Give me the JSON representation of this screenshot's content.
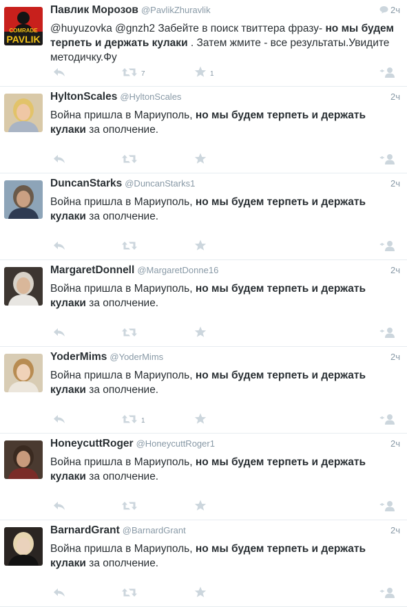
{
  "tweets": [
    {
      "name": "Павлик Морозов",
      "handle": "@PavlikZhuravlik",
      "time": "2ч",
      "has_conversation": true,
      "text": [
        {
          "t": "@huyuzovka @gnzh2 Забейте в поиск твиттера фразу- ",
          "b": false
        },
        {
          "t": "но мы будем терпеть и держать кулаки",
          "b": true
        },
        {
          "t": " . Затем жмите - все результаты.Увидите методичку.Фу",
          "b": false
        }
      ],
      "retweets": "7",
      "favorites": "1",
      "avatar": {
        "kind": "comrade",
        "top": "COMRADE",
        "bottom": "PAVLIK"
      }
    },
    {
      "name": "HyltonScales",
      "handle": "@HyltonScales",
      "time": "2ч",
      "has_conversation": false,
      "text": [
        {
          "t": "Война пришла в Мариуполь, ",
          "b": false
        },
        {
          "t": "но мы будем терпеть и держать кулаки",
          "b": true
        },
        {
          "t": " за ополчение.",
          "b": false
        }
      ],
      "retweets": "",
      "favorites": "",
      "avatar": {
        "kind": "photo",
        "bg": "#d9c9a8",
        "hair": "#e2c36a",
        "skin": "#efc7a5",
        "body": "#a9b4c4"
      }
    },
    {
      "name": "DuncanStarks",
      "handle": "@DuncanStarks1",
      "time": "2ч",
      "has_conversation": false,
      "text": [
        {
          "t": "Война пришла в Мариуполь, ",
          "b": false
        },
        {
          "t": "но мы будем терпеть и держать кулаки",
          "b": true
        },
        {
          "t": " за ополчение.",
          "b": false
        }
      ],
      "retweets": "",
      "favorites": "",
      "avatar": {
        "kind": "photo",
        "bg": "#8da4b8",
        "hair": "#6b5a4a",
        "skin": "#caa083",
        "body": "#2f3b52"
      }
    },
    {
      "name": "MargaretDonnell",
      "handle": "@MargaretDonne16",
      "time": "2ч",
      "has_conversation": false,
      "text": [
        {
          "t": "Война пришла в Мариуполь, ",
          "b": false
        },
        {
          "t": "но мы будем терпеть и держать кулаки",
          "b": true
        },
        {
          "t": " за ополчение.",
          "b": false
        }
      ],
      "retweets": "",
      "favorites": "",
      "avatar": {
        "kind": "photo",
        "bg": "#3d3631",
        "hair": "#d8d2c8",
        "skin": "#d9b79a",
        "body": "#e8e6e2"
      }
    },
    {
      "name": "YoderMims",
      "handle": "@YoderMims",
      "time": "2ч",
      "has_conversation": false,
      "text": [
        {
          "t": "Война пришла в Мариуполь, ",
          "b": false
        },
        {
          "t": "но мы будем терпеть и держать кулаки",
          "b": true
        },
        {
          "t": " за ополчение.",
          "b": false
        }
      ],
      "retweets": "1",
      "favorites": "",
      "avatar": {
        "kind": "photo",
        "bg": "#d8ccb4",
        "hair": "#b88c52",
        "skin": "#f0d2b8",
        "body": "#ece6dc"
      }
    },
    {
      "name": "HoneycuttRoger",
      "handle": "@HoneycuttRoger1",
      "time": "2ч",
      "has_conversation": false,
      "text": [
        {
          "t": "Война пришла в Мариуполь, ",
          "b": false
        },
        {
          "t": "но мы будем терпеть и держать кулаки",
          "b": true
        },
        {
          "t": " за ополчение.",
          "b": false
        }
      ],
      "retweets": "",
      "favorites": "",
      "avatar": {
        "kind": "photo",
        "bg": "#4a3a30",
        "hair": "#3a2a20",
        "skin": "#c89a7c",
        "body": "#7a2c28"
      }
    },
    {
      "name": "BarnardGrant",
      "handle": "@BarnardGrant",
      "time": "2ч",
      "has_conversation": false,
      "text": [
        {
          "t": "Война пришла в Мариуполь, ",
          "b": false
        },
        {
          "t": "но мы будем терпеть и держать кулаки",
          "b": true
        },
        {
          "t": " за ополчение.",
          "b": false
        }
      ],
      "retweets": "",
      "favorites": "",
      "avatar": {
        "kind": "photo",
        "bg": "#2a2522",
        "hair": "#e6d5b0",
        "skin": "#ead2bc",
        "body": "#121212"
      }
    }
  ],
  "icons": {
    "reply": "reply-icon",
    "retweet": "retweet-icon",
    "favorite": "star-icon",
    "follow": "follow-icon",
    "conversation": "conversation-icon"
  },
  "colors": {
    "name": "#292f33",
    "meta": "#8899a6",
    "icon": "#ccd6dd",
    "divider": "#e6ecf0",
    "comrade_red": "#c8201c",
    "comrade_yellow": "#f2c218"
  }
}
